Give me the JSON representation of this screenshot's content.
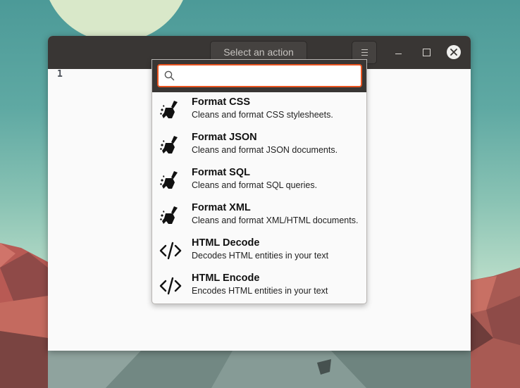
{
  "window": {
    "action_button_label": "Select an action"
  },
  "editor": {
    "line_number": "1"
  },
  "search": {
    "placeholder": "",
    "value": ""
  },
  "actions": [
    {
      "name": "Format CSS",
      "description": "Cleans and format CSS stylesheets.",
      "icon": "broom-icon"
    },
    {
      "name": "Format JSON",
      "description": "Cleans and format JSON documents.",
      "icon": "broom-icon"
    },
    {
      "name": "Format SQL",
      "description": "Cleans and format SQL queries.",
      "icon": "broom-icon"
    },
    {
      "name": "Format XML",
      "description": "Cleans and format XML/HTML documents.",
      "icon": "broom-icon"
    },
    {
      "name": "HTML Decode",
      "description": "Decodes HTML entities in your text",
      "icon": "code-icon"
    },
    {
      "name": "HTML Encode",
      "description": "Encodes HTML entities in your text",
      "icon": "code-icon"
    }
  ],
  "colors": {
    "titlebar": "#393634",
    "accent": "#e95420",
    "editor_bg": "#fafafa"
  }
}
